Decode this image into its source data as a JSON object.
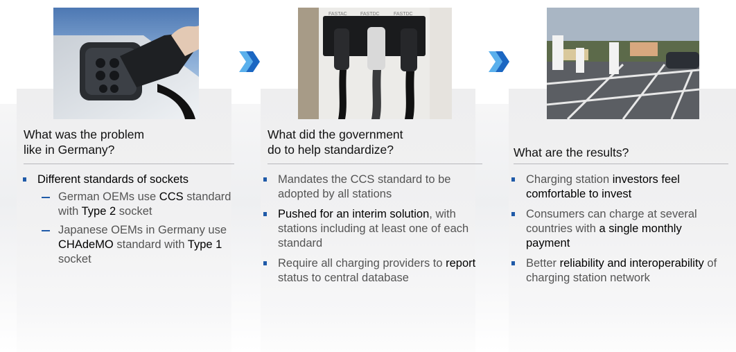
{
  "columns": [
    {
      "image_icon": "ev-plug-into-socket",
      "heading": [
        "What was the problem",
        "like in Germany?"
      ],
      "bullets": [
        {
          "parts": [
            {
              "t": "Different standards of sockets",
              "strong": true
            }
          ],
          "sub": [
            {
              "parts": [
                {
                  "t": "German OEMs use ",
                  "strong": false
                },
                {
                  "t": "CCS",
                  "strong": true
                },
                {
                  "t": " standard with ",
                  "strong": false
                },
                {
                  "t": "Type 2",
                  "strong": true
                },
                {
                  "t": " socket",
                  "strong": false
                }
              ]
            },
            {
              "parts": [
                {
                  "t": "Japanese OEMs in Germany use ",
                  "strong": false
                },
                {
                  "t": "CHAdeMO",
                  "strong": true
                },
                {
                  "t": " standard with ",
                  "strong": false
                },
                {
                  "t": "Type 1",
                  "strong": true
                },
                {
                  "t": " socket",
                  "strong": false
                }
              ]
            }
          ]
        }
      ]
    },
    {
      "image_icon": "fast-charger-connectors",
      "image_labels": [
        "FASTAC",
        "FASTDC",
        "FASTDC"
      ],
      "heading": [
        "What did the government",
        "do to help standardize?"
      ],
      "bullets": [
        {
          "parts": [
            {
              "t": "Mandates the CCS standard to be adopted by all stations",
              "strong": false
            }
          ]
        },
        {
          "parts": [
            {
              "t": "Pushed for an interim solution",
              "strong": true
            },
            {
              "t": ", with stations including at least one of each standard",
              "strong": false
            }
          ]
        },
        {
          "parts": [
            {
              "t": "Require all charging providers to ",
              "strong": false
            },
            {
              "t": "report",
              "strong": true
            },
            {
              "t": " status to central database",
              "strong": false
            }
          ]
        }
      ]
    },
    {
      "image_icon": "charging-station-parking-lot",
      "heading": [
        "What are the results?"
      ],
      "bullets": [
        {
          "parts": [
            {
              "t": "Charging station ",
              "strong": false
            },
            {
              "t": "investors feel comfortable to invest",
              "strong": true
            }
          ]
        },
        {
          "parts": [
            {
              "t": "Consumers can charge at several countries with ",
              "strong": false
            },
            {
              "t": "a single monthly payment",
              "strong": true
            }
          ]
        },
        {
          "parts": [
            {
              "t": "Better ",
              "strong": false
            },
            {
              "t": "reliability and interoperability",
              "strong": true
            },
            {
              "t": " of charging station network",
              "strong": false
            }
          ]
        }
      ]
    }
  ],
  "arrow_icon": "double-chevron-right-icon",
  "colors": {
    "accent": "#1f5aa8",
    "chevron_light": "#5ab0ec",
    "chevron_dark": "#1b67c2",
    "body_text": "#545454",
    "strong_text": "#000000"
  }
}
